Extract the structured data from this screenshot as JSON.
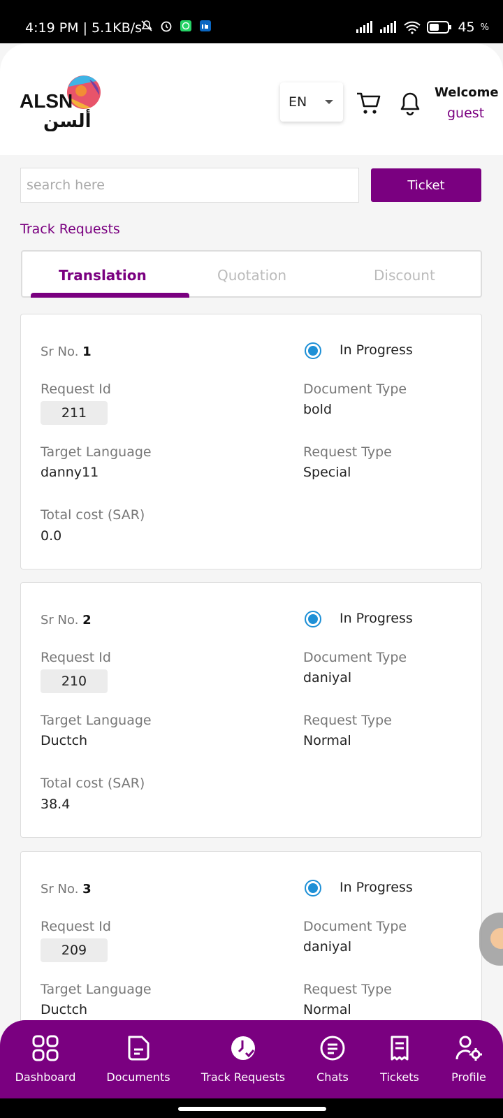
{
  "status_bar": {
    "time": "4:19 PM | 5.1KB/s",
    "battery": "45"
  },
  "header": {
    "logo_text": "ALSN",
    "logo_arabic": "ألسن",
    "language": "EN",
    "welcome": "Welcome",
    "user": "guest"
  },
  "search": {
    "placeholder": "search here",
    "ticket_label": "Ticket"
  },
  "page_title": "Track Requests",
  "tabs": [
    {
      "label": "Translation",
      "active": true
    },
    {
      "label": "Quotation",
      "active": false
    },
    {
      "label": "Discount",
      "active": false
    }
  ],
  "labels": {
    "sr_no": "Sr No.",
    "request_id": "Request Id",
    "document_type": "Document Type",
    "target_language": "Target Language",
    "request_type": "Request Type",
    "total_cost": "Total cost (SAR)"
  },
  "requests": [
    {
      "sr": "1",
      "status": "In Progress",
      "request_id": "211",
      "document_type": "bold",
      "target_language": "danny11",
      "request_type": "Special",
      "total_cost": "0.0"
    },
    {
      "sr": "2",
      "status": "In Progress",
      "request_id": "210",
      "document_type": "daniyal",
      "target_language": "Ductch",
      "request_type": "Normal",
      "total_cost": "38.4"
    },
    {
      "sr": "3",
      "status": "In Progress",
      "request_id": "209",
      "document_type": "daniyal",
      "target_language": "Ductch",
      "request_type": "Normal",
      "total_cost": ""
    }
  ],
  "bottom_nav": [
    {
      "label": "Dashboard",
      "icon": "grid-icon"
    },
    {
      "label": "Documents",
      "icon": "document-icon"
    },
    {
      "label": "Track Requests",
      "icon": "clock-check-icon"
    },
    {
      "label": "Chats",
      "icon": "chat-icon"
    },
    {
      "label": "Tickets",
      "icon": "receipt-icon"
    },
    {
      "label": "Profile",
      "icon": "user-settings-icon"
    }
  ],
  "colors": {
    "brand": "#7a0080",
    "status_dot": "#1e90d6"
  }
}
